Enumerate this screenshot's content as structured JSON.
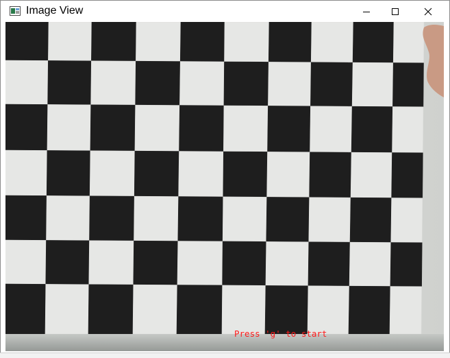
{
  "window": {
    "title": "Image View",
    "icon": "image-window-icon"
  },
  "controls": {
    "minimize_icon": "minimize-icon",
    "maximize_icon": "maximize-icon",
    "close_icon": "close-icon"
  },
  "camera_view": {
    "subject": "checkerboard-calibration-pattern",
    "overlay_text": "Press 'g' to start",
    "overlay_color": "#ff1a1a",
    "square_dark_color": "#1e1e1e",
    "square_light_color": "#e6e7e5"
  }
}
